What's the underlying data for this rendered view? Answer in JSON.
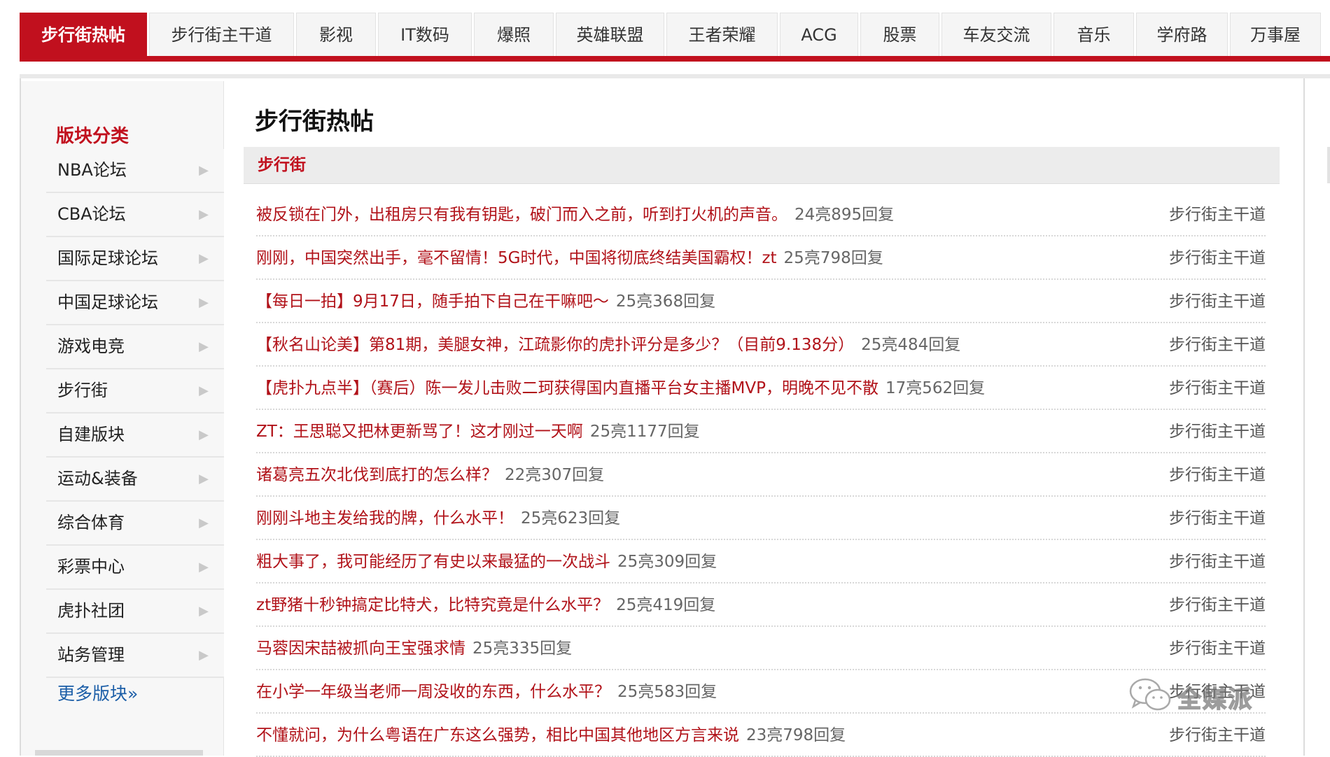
{
  "topnav": {
    "tabs": [
      {
        "label": "步行街热帖",
        "active": true
      },
      {
        "label": "步行街主干道"
      },
      {
        "label": "影视"
      },
      {
        "label": "IT数码"
      },
      {
        "label": "爆照"
      },
      {
        "label": "英雄联盟"
      },
      {
        "label": "王者荣耀"
      },
      {
        "label": "ACG"
      },
      {
        "label": "股票"
      },
      {
        "label": "车友交流"
      },
      {
        "label": "音乐"
      },
      {
        "label": "学府路"
      },
      {
        "label": "万事屋"
      }
    ]
  },
  "sidebar": {
    "title": "版块分类",
    "items": [
      {
        "label": "NBA论坛"
      },
      {
        "label": "CBA论坛"
      },
      {
        "label": "国际足球论坛"
      },
      {
        "label": "中国足球论坛"
      },
      {
        "label": "游戏电竞"
      },
      {
        "label": "步行街"
      },
      {
        "label": "自建版块"
      },
      {
        "label": "运动&装备"
      },
      {
        "label": "综合体育"
      },
      {
        "label": "彩票中心"
      },
      {
        "label": "虎扑社团"
      },
      {
        "label": "站务管理"
      }
    ],
    "more_label": "更多版块»"
  },
  "main": {
    "title": "步行街热帖",
    "section_label": "步行街",
    "posts": [
      {
        "title": "被反锁在门外，出租房只有我有钥匙，破门而入之前，听到打火机的声音。",
        "stats": "24亮895回复",
        "board": "步行街主干道"
      },
      {
        "title": "刚刚，中国突然出手，毫不留情！5G时代，中国将彻底终结美国霸权！zt",
        "stats": "25亮798回复",
        "board": "步行街主干道"
      },
      {
        "title": "【每日一拍】9月17日，随手拍下自己在干嘛吧～",
        "stats": "25亮368回复",
        "board": "步行街主干道"
      },
      {
        "title": "【秋名山论美】第81期，美腿女神，江疏影你的虎扑评分是多少？（目前9.138分）",
        "stats": "25亮484回复",
        "board": "步行街主干道"
      },
      {
        "title": "【虎扑九点半】（赛后）陈一发儿击败二珂获得国内直播平台女主播MVP，明晚不见不散",
        "stats": "17亮562回复",
        "board": "步行街主干道"
      },
      {
        "title": "ZT：王思聪又把林更新骂了！这才刚过一天啊",
        "stats": "25亮1177回复",
        "board": "步行街主干道"
      },
      {
        "title": "诸葛亮五次北伐到底打的怎么样？",
        "stats": "22亮307回复",
        "board": "步行街主干道"
      },
      {
        "title": "刚刚斗地主发给我的牌，什么水平！",
        "stats": "25亮623回复",
        "board": "步行街主干道"
      },
      {
        "title": "粗大事了，我可能经历了有史以来最猛的一次战斗",
        "stats": "25亮309回复",
        "board": "步行街主干道"
      },
      {
        "title": "zt野猪十秒钟搞定比特犬，比特究竟是什么水平？",
        "stats": "25亮419回复",
        "board": "步行街主干道"
      },
      {
        "title": "马蓉因宋喆被抓向王宝强求情",
        "stats": "25亮335回复",
        "board": "步行街主干道"
      },
      {
        "title": "在小学一年级当老师一周没收的东西，什么水平？",
        "stats": "25亮583回复",
        "board": "步行街主干道"
      },
      {
        "title": "不懂就问，为什么粤语在广东这么强势，相比中国其他地区方言来说",
        "stats": "23亮798回复",
        "board": "步行街主干道"
      }
    ]
  },
  "watermark": {
    "text": "全媒派",
    "icon": "wechat-icon"
  },
  "colors": {
    "brand_red": "#c1101e",
    "link_red": "#b11219",
    "more_blue": "#1d5fa8"
  }
}
